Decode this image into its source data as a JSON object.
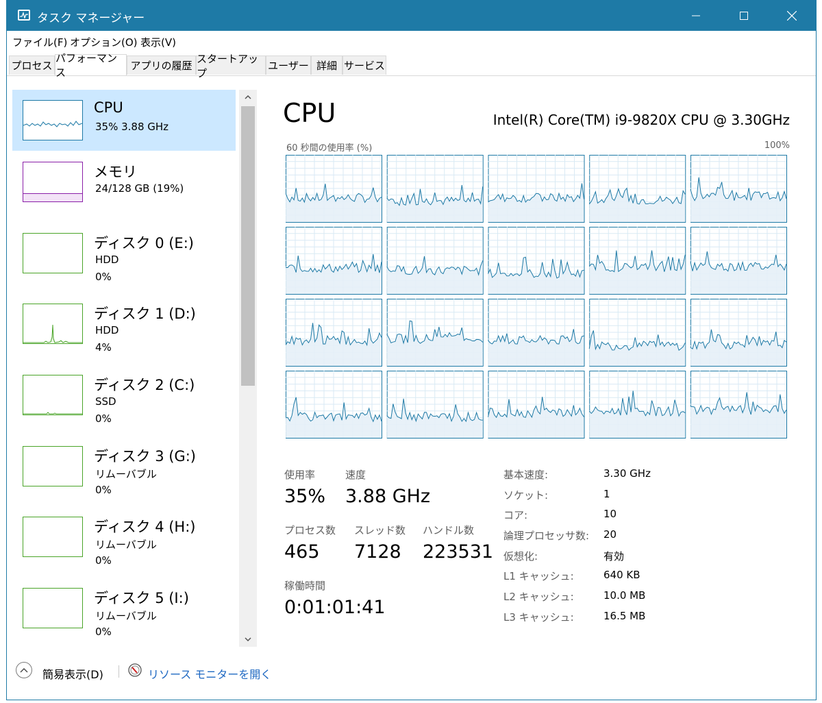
{
  "window": {
    "title": "タスク マネージャー",
    "accent": "#1e7aa6",
    "controls": [
      "minimize-icon",
      "maximize-icon",
      "close-icon"
    ]
  },
  "menu": [
    "ファイル(F)",
    "オプション(O)",
    "表示(V)"
  ],
  "tabs": [
    "プロセス",
    "パフォーマンス",
    "アプリの履歴",
    "スタートアップ",
    "ユーザー",
    "詳細",
    "サービス"
  ],
  "active_tab": "パフォーマンス",
  "sidebar": {
    "items": [
      {
        "title": "CPU",
        "line1": "35%  3.88 GHz",
        "line2": "",
        "color": "#1e7aa6",
        "selected": true
      },
      {
        "title": "メモリ",
        "line1": "24/128 GB (19%)",
        "line2": "",
        "color": "#8a1fa8",
        "fill": 0.19
      },
      {
        "title": "ディスク 0 (E:)",
        "line1": "HDD",
        "line2": "0%",
        "color": "#4aa428"
      },
      {
        "title": "ディスク 1 (D:)",
        "line1": "HDD",
        "line2": "4%",
        "color": "#4aa428"
      },
      {
        "title": "ディスク 2 (C:)",
        "line1": "SSD",
        "line2": "0%",
        "color": "#4aa428"
      },
      {
        "title": "ディスク 3 (G:)",
        "line1": "リムーバブル",
        "line2": "0%",
        "color": "#4aa428"
      },
      {
        "title": "ディスク 4 (H:)",
        "line1": "リムーバブル",
        "line2": "0%",
        "color": "#4aa428"
      },
      {
        "title": "ディスク 5 (I:)",
        "line1": "リムーバブル",
        "line2": "0%",
        "color": "#4aa428"
      }
    ]
  },
  "main": {
    "title": "CPU",
    "model": "Intel(R) Core(TM) i9-9820X CPU @ 3.30GHz",
    "graph_label": "60 秒間の使用率 (%)",
    "graph_max": "100%",
    "graph_grid": {
      "rows": 4,
      "cols": 5
    },
    "stats": {
      "usage_label": "使用率",
      "usage": "35%",
      "speed_label": "速度",
      "speed": "3.88 GHz",
      "proc_label": "プロセス数",
      "proc": "465",
      "threads_label": "スレッド数",
      "threads": "7128",
      "handles_label": "ハンドル数",
      "handles": "223531",
      "uptime_label": "稼働時間",
      "uptime": "0:01:01:41"
    },
    "props": [
      {
        "label": "基本速度:",
        "value": "3.30 GHz"
      },
      {
        "label": "ソケット:",
        "value": "1"
      },
      {
        "label": "コア:",
        "value": "10"
      },
      {
        "label": "論理プロセッサ数:",
        "value": "20"
      },
      {
        "label": "仮想化:",
        "value": "有効"
      },
      {
        "label": "L1 キャッシュ:",
        "value": "640 KB"
      },
      {
        "label": "L2 キャッシュ:",
        "value": "10.0 MB"
      },
      {
        "label": "L3 キャッシュ:",
        "value": "16.5 MB"
      }
    ]
  },
  "footer": {
    "fewer_details": "簡易表示(D)",
    "resource_monitor": "リソース モニターを開く"
  }
}
